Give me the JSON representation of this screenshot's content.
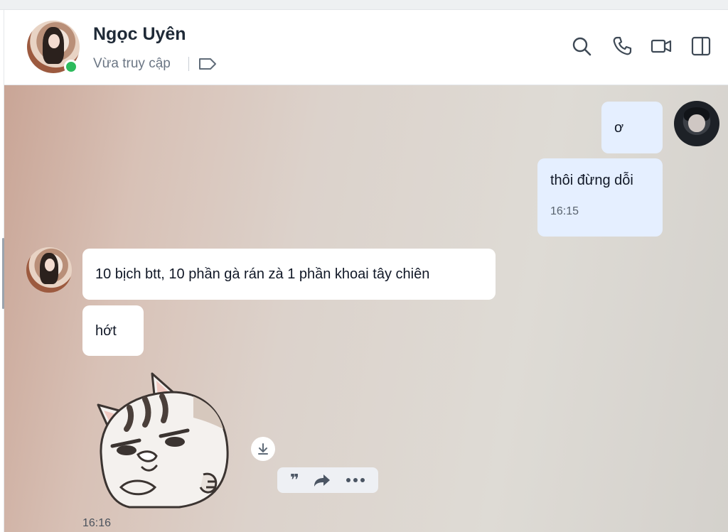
{
  "header": {
    "contact_name": "Ngọc Uyên",
    "status": "Vừa truy cập",
    "online": true,
    "icons": [
      "search-icon",
      "phone-icon",
      "video-call-icon",
      "sidebar-toggle-icon",
      "tag-icon"
    ]
  },
  "messages": [
    {
      "from": "me",
      "text": "ơ"
    },
    {
      "from": "me",
      "text": "thôi đừng dỗi",
      "time": "16:15"
    },
    {
      "from": "them",
      "text": "10 bịch btt, 10 phần gà rán zà 1 phần khoai tây chiên"
    },
    {
      "from": "them",
      "text": "hớt"
    },
    {
      "from": "them",
      "type": "sticker",
      "sticker": "grumpy-cat-sticker",
      "time": "16:16"
    }
  ],
  "message_actions": [
    "quote-icon",
    "forward-icon",
    "more-icon"
  ],
  "colors": {
    "my_bubble": "#e5efff",
    "their_bubble": "#ffffff",
    "online": "#2dbb5d",
    "name_text": "#1f2a37"
  }
}
